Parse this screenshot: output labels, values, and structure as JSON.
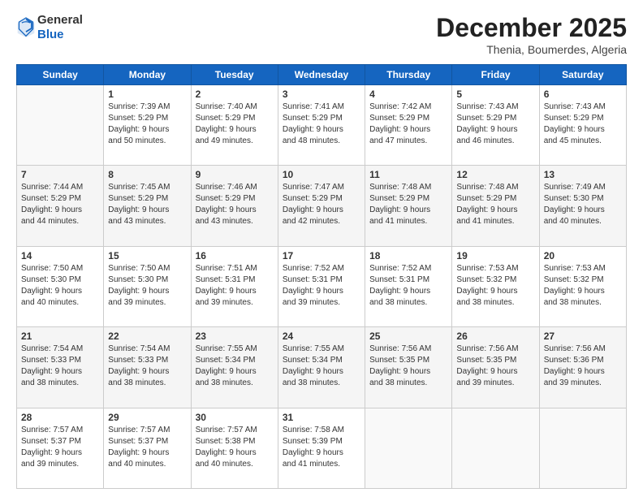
{
  "logo": {
    "general": "General",
    "blue": "Blue"
  },
  "title": "December 2025",
  "subtitle": "Thenia, Boumerdes, Algeria",
  "days_header": [
    "Sunday",
    "Monday",
    "Tuesday",
    "Wednesday",
    "Thursday",
    "Friday",
    "Saturday"
  ],
  "weeks": [
    [
      {
        "day": "",
        "info": ""
      },
      {
        "day": "1",
        "info": "Sunrise: 7:39 AM\nSunset: 5:29 PM\nDaylight: 9 hours\nand 50 minutes."
      },
      {
        "day": "2",
        "info": "Sunrise: 7:40 AM\nSunset: 5:29 PM\nDaylight: 9 hours\nand 49 minutes."
      },
      {
        "day": "3",
        "info": "Sunrise: 7:41 AM\nSunset: 5:29 PM\nDaylight: 9 hours\nand 48 minutes."
      },
      {
        "day": "4",
        "info": "Sunrise: 7:42 AM\nSunset: 5:29 PM\nDaylight: 9 hours\nand 47 minutes."
      },
      {
        "day": "5",
        "info": "Sunrise: 7:43 AM\nSunset: 5:29 PM\nDaylight: 9 hours\nand 46 minutes."
      },
      {
        "day": "6",
        "info": "Sunrise: 7:43 AM\nSunset: 5:29 PM\nDaylight: 9 hours\nand 45 minutes."
      }
    ],
    [
      {
        "day": "7",
        "info": "Sunrise: 7:44 AM\nSunset: 5:29 PM\nDaylight: 9 hours\nand 44 minutes."
      },
      {
        "day": "8",
        "info": "Sunrise: 7:45 AM\nSunset: 5:29 PM\nDaylight: 9 hours\nand 43 minutes."
      },
      {
        "day": "9",
        "info": "Sunrise: 7:46 AM\nSunset: 5:29 PM\nDaylight: 9 hours\nand 43 minutes."
      },
      {
        "day": "10",
        "info": "Sunrise: 7:47 AM\nSunset: 5:29 PM\nDaylight: 9 hours\nand 42 minutes."
      },
      {
        "day": "11",
        "info": "Sunrise: 7:48 AM\nSunset: 5:29 PM\nDaylight: 9 hours\nand 41 minutes."
      },
      {
        "day": "12",
        "info": "Sunrise: 7:48 AM\nSunset: 5:29 PM\nDaylight: 9 hours\nand 41 minutes."
      },
      {
        "day": "13",
        "info": "Sunrise: 7:49 AM\nSunset: 5:30 PM\nDaylight: 9 hours\nand 40 minutes."
      }
    ],
    [
      {
        "day": "14",
        "info": "Sunrise: 7:50 AM\nSunset: 5:30 PM\nDaylight: 9 hours\nand 40 minutes."
      },
      {
        "day": "15",
        "info": "Sunrise: 7:50 AM\nSunset: 5:30 PM\nDaylight: 9 hours\nand 39 minutes."
      },
      {
        "day": "16",
        "info": "Sunrise: 7:51 AM\nSunset: 5:31 PM\nDaylight: 9 hours\nand 39 minutes."
      },
      {
        "day": "17",
        "info": "Sunrise: 7:52 AM\nSunset: 5:31 PM\nDaylight: 9 hours\nand 39 minutes."
      },
      {
        "day": "18",
        "info": "Sunrise: 7:52 AM\nSunset: 5:31 PM\nDaylight: 9 hours\nand 38 minutes."
      },
      {
        "day": "19",
        "info": "Sunrise: 7:53 AM\nSunset: 5:32 PM\nDaylight: 9 hours\nand 38 minutes."
      },
      {
        "day": "20",
        "info": "Sunrise: 7:53 AM\nSunset: 5:32 PM\nDaylight: 9 hours\nand 38 minutes."
      }
    ],
    [
      {
        "day": "21",
        "info": "Sunrise: 7:54 AM\nSunset: 5:33 PM\nDaylight: 9 hours\nand 38 minutes."
      },
      {
        "day": "22",
        "info": "Sunrise: 7:54 AM\nSunset: 5:33 PM\nDaylight: 9 hours\nand 38 minutes."
      },
      {
        "day": "23",
        "info": "Sunrise: 7:55 AM\nSunset: 5:34 PM\nDaylight: 9 hours\nand 38 minutes."
      },
      {
        "day": "24",
        "info": "Sunrise: 7:55 AM\nSunset: 5:34 PM\nDaylight: 9 hours\nand 38 minutes."
      },
      {
        "day": "25",
        "info": "Sunrise: 7:56 AM\nSunset: 5:35 PM\nDaylight: 9 hours\nand 38 minutes."
      },
      {
        "day": "26",
        "info": "Sunrise: 7:56 AM\nSunset: 5:35 PM\nDaylight: 9 hours\nand 39 minutes."
      },
      {
        "day": "27",
        "info": "Sunrise: 7:56 AM\nSunset: 5:36 PM\nDaylight: 9 hours\nand 39 minutes."
      }
    ],
    [
      {
        "day": "28",
        "info": "Sunrise: 7:57 AM\nSunset: 5:37 PM\nDaylight: 9 hours\nand 39 minutes."
      },
      {
        "day": "29",
        "info": "Sunrise: 7:57 AM\nSunset: 5:37 PM\nDaylight: 9 hours\nand 40 minutes."
      },
      {
        "day": "30",
        "info": "Sunrise: 7:57 AM\nSunset: 5:38 PM\nDaylight: 9 hours\nand 40 minutes."
      },
      {
        "day": "31",
        "info": "Sunrise: 7:58 AM\nSunset: 5:39 PM\nDaylight: 9 hours\nand 41 minutes."
      },
      {
        "day": "",
        "info": ""
      },
      {
        "day": "",
        "info": ""
      },
      {
        "day": "",
        "info": ""
      }
    ]
  ]
}
